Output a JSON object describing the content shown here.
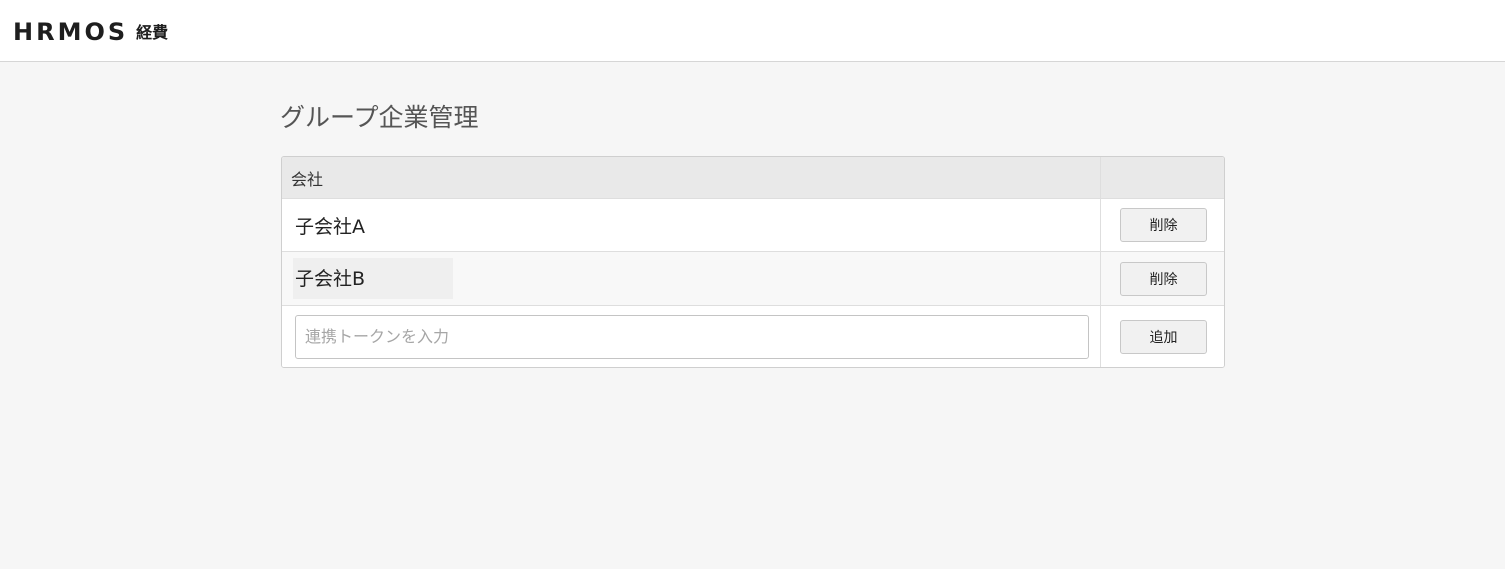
{
  "header": {
    "logo_text": "HRMOS",
    "logo_sub": "経費"
  },
  "page": {
    "title": "グループ企業管理"
  },
  "table": {
    "column_company": "会社",
    "rows": [
      {
        "name": "子会社A",
        "action_label": "削除"
      },
      {
        "name": "子会社B",
        "action_label": "削除"
      }
    ],
    "add_row": {
      "placeholder": "連携トークンを入力",
      "value": "",
      "action_label": "追加"
    }
  }
}
